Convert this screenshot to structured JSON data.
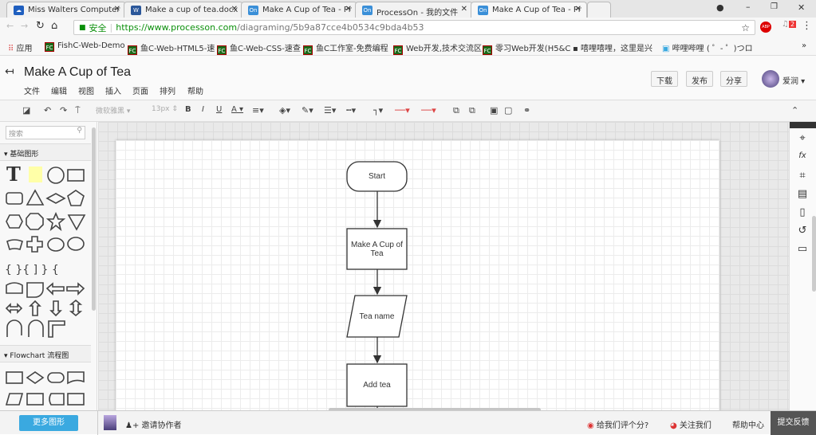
{
  "browser": {
    "tabs": [
      {
        "label": "Miss Walters Computer",
        "icon": "cloud-icon"
      },
      {
        "label": "Make a cup of tea.docx",
        "icon": "word-icon"
      },
      {
        "label": "Make A Cup of Tea - Pr",
        "icon": "processon-icon"
      },
      {
        "label": "ProcessOn - 我的文件",
        "icon": "processon-icon"
      },
      {
        "label": "Make A Cup of Tea - Pr",
        "icon": "processon-icon",
        "active": true
      }
    ],
    "secure_label": "安全",
    "url_host": "https://www.processon.com",
    "url_path": "/diagraming/5b9a87cce4b0534c9bda4b53",
    "extension_badge": "2",
    "bookmarks": [
      "应用",
      "FishC-Web-Demo",
      "鱼C-Web-HTML5-速",
      "鱼C-Web-CSS-速查",
      "鱼C工作室-免费编程",
      "Web开发,技术交流区",
      "零习Web开发(H5&C",
      "嘻哩嘻哩，这里是兴",
      "哔哩哔哩 ( ゜- ゜)つロ"
    ]
  },
  "app": {
    "title": "Make A Cup of Tea",
    "menu": [
      "文件",
      "编辑",
      "视图",
      "插入",
      "页面",
      "排列",
      "帮助"
    ],
    "buttons": {
      "download": "下载",
      "publish": "发布",
      "share": "分享"
    },
    "user": "爱润",
    "toolbar": {
      "font": "微软雅黑",
      "font_size": "13px"
    }
  },
  "sidebar": {
    "search_placeholder": "搜索",
    "categories": [
      "基础图形",
      "Flowchart 流程图"
    ],
    "more_shapes": "更多图形"
  },
  "diagram": {
    "nodes": [
      {
        "label": "Start",
        "shape": "terminator"
      },
      {
        "label": "Make A Cup of Tea",
        "shape": "process"
      },
      {
        "label": "Tea name",
        "shape": "data"
      },
      {
        "label": "Add tea",
        "shape": "process"
      }
    ]
  },
  "footer": {
    "invite": "邀请协作者",
    "rate": "给我们评个分?",
    "follow": "关注我们",
    "help": "帮助中心",
    "feedback": "提交反馈"
  }
}
